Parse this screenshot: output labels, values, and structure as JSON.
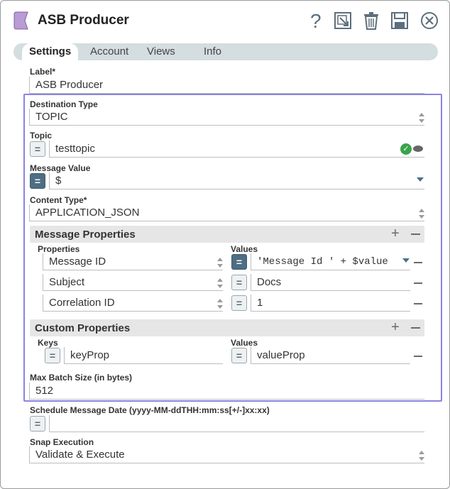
{
  "header": {
    "title": "ASB Producer",
    "accent": "#b99bd6",
    "icons": [
      "help-icon",
      "export-icon",
      "delete-icon",
      "save-icon",
      "close-icon"
    ]
  },
  "tabs": [
    {
      "label": "Settings",
      "active": true
    },
    {
      "label": "Account",
      "active": false
    },
    {
      "label": "Views",
      "active": false
    },
    {
      "label": "Info",
      "active": false
    }
  ],
  "form": {
    "label": {
      "title": "Label*",
      "value": "ASB Producer"
    },
    "destination_type": {
      "title": "Destination Type",
      "value": "TOPIC"
    },
    "topic": {
      "title": "Topic",
      "value": "testtopic"
    },
    "message_value": {
      "title": "Message Value",
      "value": "$"
    },
    "content_type": {
      "title": "Content Type*",
      "value": "APPLICATION_JSON"
    },
    "message_properties": {
      "title": "Message Properties",
      "col_properties": "Properties",
      "col_values": "Values",
      "rows": [
        {
          "property": "Message ID",
          "value": "'Message Id ' + $value"
        },
        {
          "property": "Subject",
          "value": "Docs"
        },
        {
          "property": "Correlation ID",
          "value": "1"
        }
      ]
    },
    "custom_properties": {
      "title": "Custom Properties",
      "col_keys": "Keys",
      "col_values": "Values",
      "rows": [
        {
          "key": "keyProp",
          "value": "valueProp"
        }
      ]
    },
    "max_batch_size": {
      "title": "Max Batch Size (in bytes)",
      "value": "512"
    },
    "schedule_date": {
      "title": "Schedule Message Date (yyyy-MM-ddTHH:mm:ss[+/-]xx:xx)",
      "value": ""
    },
    "snap_execution": {
      "title": "Snap Execution",
      "value": "Validate & Execute"
    }
  },
  "colors": {
    "highlight_border": "#8a84e0",
    "tab_bar": "#d4dde0",
    "expr_on": "#4d6e83",
    "valid_check": "#3aa34a"
  }
}
